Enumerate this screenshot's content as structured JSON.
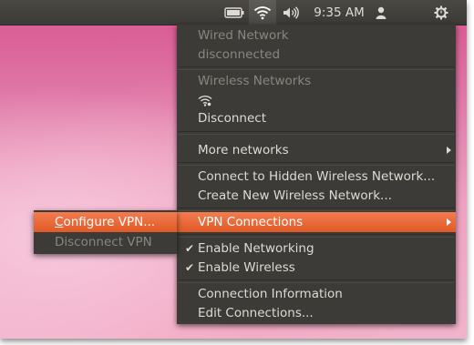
{
  "panel": {
    "clock": "9:35 AM",
    "icons": [
      "battery-icon",
      "wifi-icon",
      "volume-icon",
      "user-icon",
      "power-gear-icon"
    ]
  },
  "network_menu": {
    "wired_header": "Wired Network",
    "wired_status": "disconnected",
    "wireless_header": "Wireless Networks",
    "disconnect": "Disconnect",
    "more_networks": "More networks",
    "connect_hidden": "Connect to Hidden Wireless Network...",
    "create_new": "Create New Wireless Network...",
    "vpn_connections": "VPN Connections",
    "enable_networking": "Enable Networking",
    "enable_wireless": "Enable Wireless",
    "connection_information": "Connection Information",
    "edit_connections": "Edit Connections..."
  },
  "vpn_submenu": {
    "configure_prefix": "C",
    "configure_rest": "onfigure VPN...",
    "disconnect_vpn": "Disconnect VPN"
  },
  "colors": {
    "highlight": "#e8622f",
    "menu_bg": "#3c3b37",
    "panel_bg": "#3f3e3a"
  }
}
